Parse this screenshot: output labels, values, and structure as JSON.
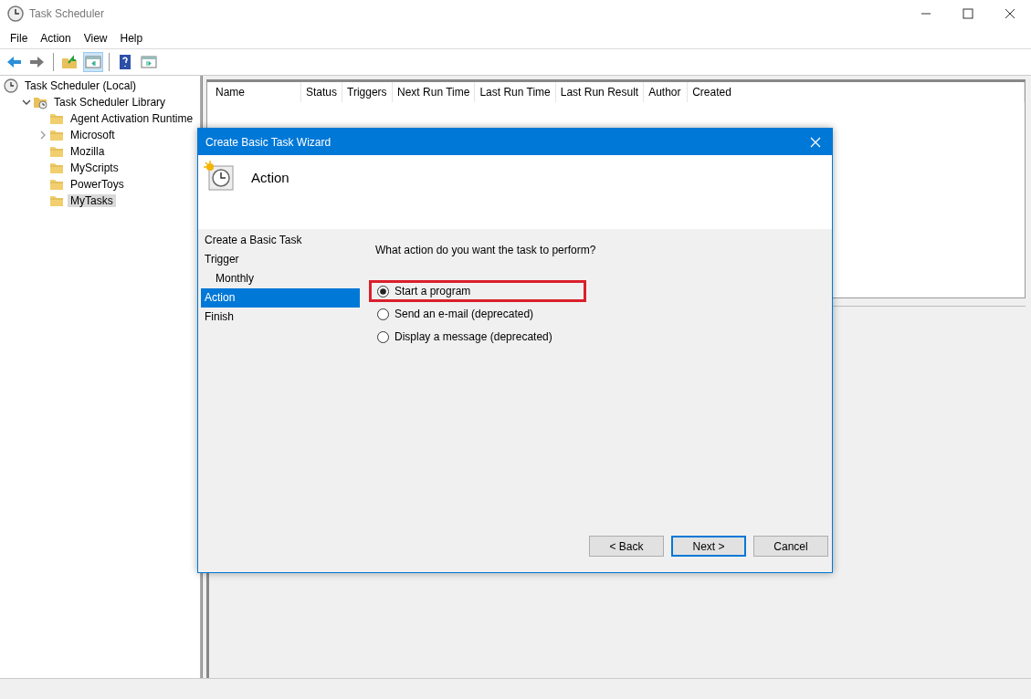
{
  "window": {
    "title": "Task Scheduler"
  },
  "menu": [
    "File",
    "Action",
    "View",
    "Help"
  ],
  "toolbar": [
    {
      "kind": "back"
    },
    {
      "kind": "forward"
    },
    {
      "kind": "sep"
    },
    {
      "kind": "folder"
    },
    {
      "kind": "pane",
      "selected": true
    },
    {
      "kind": "sep"
    },
    {
      "kind": "help"
    },
    {
      "kind": "pane2",
      "selected": false
    }
  ],
  "tree": [
    {
      "label": "Task Scheduler (Local)",
      "kind": "clock",
      "selected": false,
      "children": [
        {
          "label": "Task Scheduler Library",
          "kind": "library",
          "expanded": true,
          "selected": false,
          "children": [
            {
              "label": "Agent Activation Runtime",
              "kind": "folder",
              "selected": false
            },
            {
              "label": "Microsoft",
              "kind": "folder",
              "expanded": false,
              "selected": false
            },
            {
              "label": "Mozilla",
              "kind": "folder",
              "selected": false
            },
            {
              "label": "MyScripts",
              "kind": "folder",
              "selected": false
            },
            {
              "label": "PowerToys",
              "kind": "folder",
              "selected": false
            },
            {
              "label": "MyTasks",
              "kind": "folder",
              "selected": true
            }
          ]
        }
      ]
    }
  ],
  "table": {
    "columns": [
      "Name",
      "Status",
      "Triggers",
      "Next Run Time",
      "Last Run Time",
      "Last Run Result",
      "Author",
      "Created"
    ]
  },
  "dialog": {
    "title": "Create Basic Task Wizard",
    "heading": "Action",
    "steps": [
      {
        "label": "Create a Basic Task",
        "selected": false
      },
      {
        "label": "Trigger",
        "selected": false,
        "children": [
          {
            "label": "Monthly",
            "selected": false
          }
        ]
      },
      {
        "label": "Action",
        "selected": true
      },
      {
        "label": "Finish",
        "selected": false
      }
    ],
    "question": "What action do you want the task to perform?",
    "options": [
      {
        "label": "Start a program",
        "selected": true,
        "highlighted": true
      },
      {
        "label": "Send an e-mail (deprecated)",
        "selected": false,
        "highlighted": false
      },
      {
        "label": "Display a message (deprecated)",
        "selected": false,
        "highlighted": false
      }
    ],
    "buttons": [
      {
        "label": "< Back",
        "default": false
      },
      {
        "label": "Next >",
        "default": true
      },
      {
        "label": "Cancel",
        "default": false
      }
    ]
  }
}
